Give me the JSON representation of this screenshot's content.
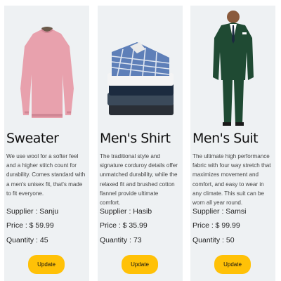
{
  "products": [
    {
      "name": "Sweater",
      "description": "We use wool for a softer feel and a higher stitch count for durability. Comes standard with a men's unisex fit, that's made to fit everyone.",
      "supplier": "Supplier : Sanju",
      "price": "Price : $ 59.99",
      "quantity": "Quantity : 45",
      "button": "Update",
      "image_icon": "pink-sweater-image"
    },
    {
      "name": "Men's Shirt",
      "description": "The traditional style and signature corduroy details offer unmatched durability, while the relaxed fit and brushed cotton flannel provide ultimate comfort.",
      "supplier": "Supplier : Hasib",
      "price": "Price : $ 35.99",
      "quantity": "Quantity : 73",
      "button": "Update",
      "image_icon": "folded-shirts-image"
    },
    {
      "name": "Men's Suit",
      "description": "The ultimate high performance fabric with four way stretch that maximizes movement and comfort, and easy to wear in any climate. This suit can be worn all year round.",
      "supplier": "Supplier : Samsi",
      "price": "Price : $ 99.99",
      "quantity": "Quantity : 50",
      "button": "Update",
      "image_icon": "green-suit-image"
    }
  ],
  "colors": {
    "card_bg": "#eef1f3",
    "button": "#ffc107",
    "sweater": "#e8a1ad",
    "suit": "#1f4a33"
  }
}
